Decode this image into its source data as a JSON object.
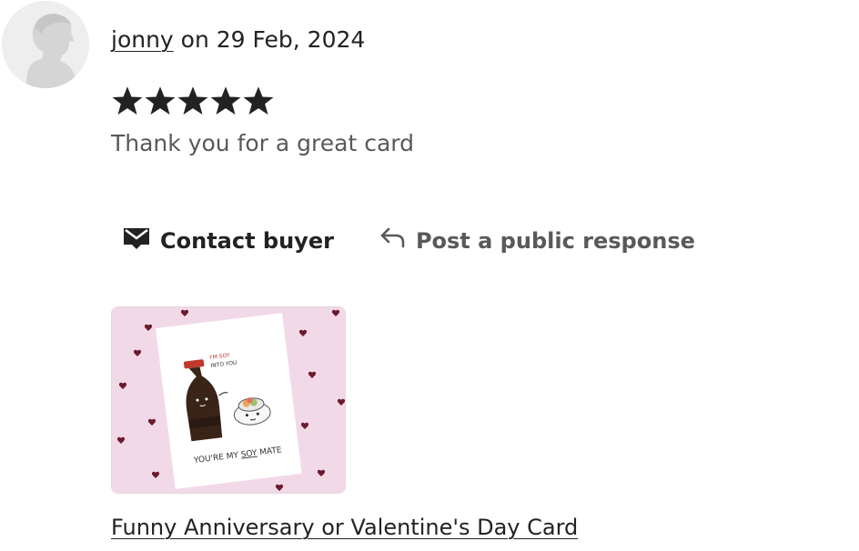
{
  "review": {
    "reviewer_name": "jonny",
    "date_text": " on 29 Feb, 2024",
    "rating": 5,
    "rating_max": 5,
    "star_color": "#222222",
    "text": "Thank you for a great card"
  },
  "actions": {
    "contact_label": "Contact buyer",
    "contact_icon": "envelope-icon",
    "respond_label": "Post a public response",
    "respond_icon": "reply-arrow-icon"
  },
  "product": {
    "title": "Funny Anniversary or Valentine's Day Card",
    "card_line_top_1": "I'M SOY",
    "card_line_top_2": "INTO YOU",
    "card_caption_pre": "YOU'RE MY ",
    "card_caption_em": "SOY",
    "card_caption_post": " MATE",
    "background_color": "#f2d9e8",
    "heart_color": "#6b1a2e"
  }
}
